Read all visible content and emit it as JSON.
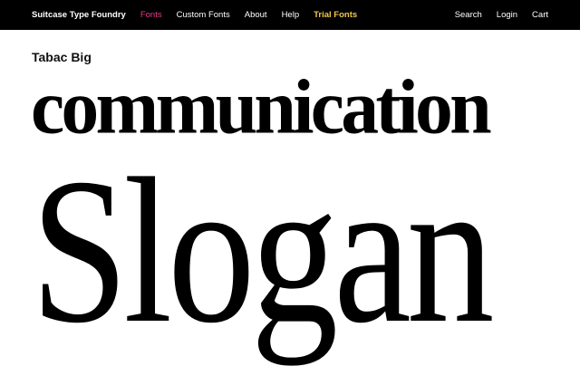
{
  "nav": {
    "brand": "Suitcase Type Foundry",
    "left_items": [
      {
        "label": "Fonts",
        "active": true
      },
      {
        "label": "Custom Fonts"
      },
      {
        "label": "About"
      },
      {
        "label": "Help"
      },
      {
        "label": "Trial Fonts",
        "highlight": true
      }
    ],
    "right_items": [
      {
        "label": "Search"
      },
      {
        "label": "Login"
      },
      {
        "label": "Cart"
      }
    ]
  },
  "specimen": {
    "family_name": "Tabac Big",
    "sample_bold": "communication",
    "sample_light": "Slogan"
  },
  "colors": {
    "nav_background": "#000000",
    "nav_text": "#ffffff",
    "active_link": "#e8378c",
    "trial_link": "#f0c84a",
    "page_background": "#ffffff",
    "specimen_text": "#000000"
  }
}
